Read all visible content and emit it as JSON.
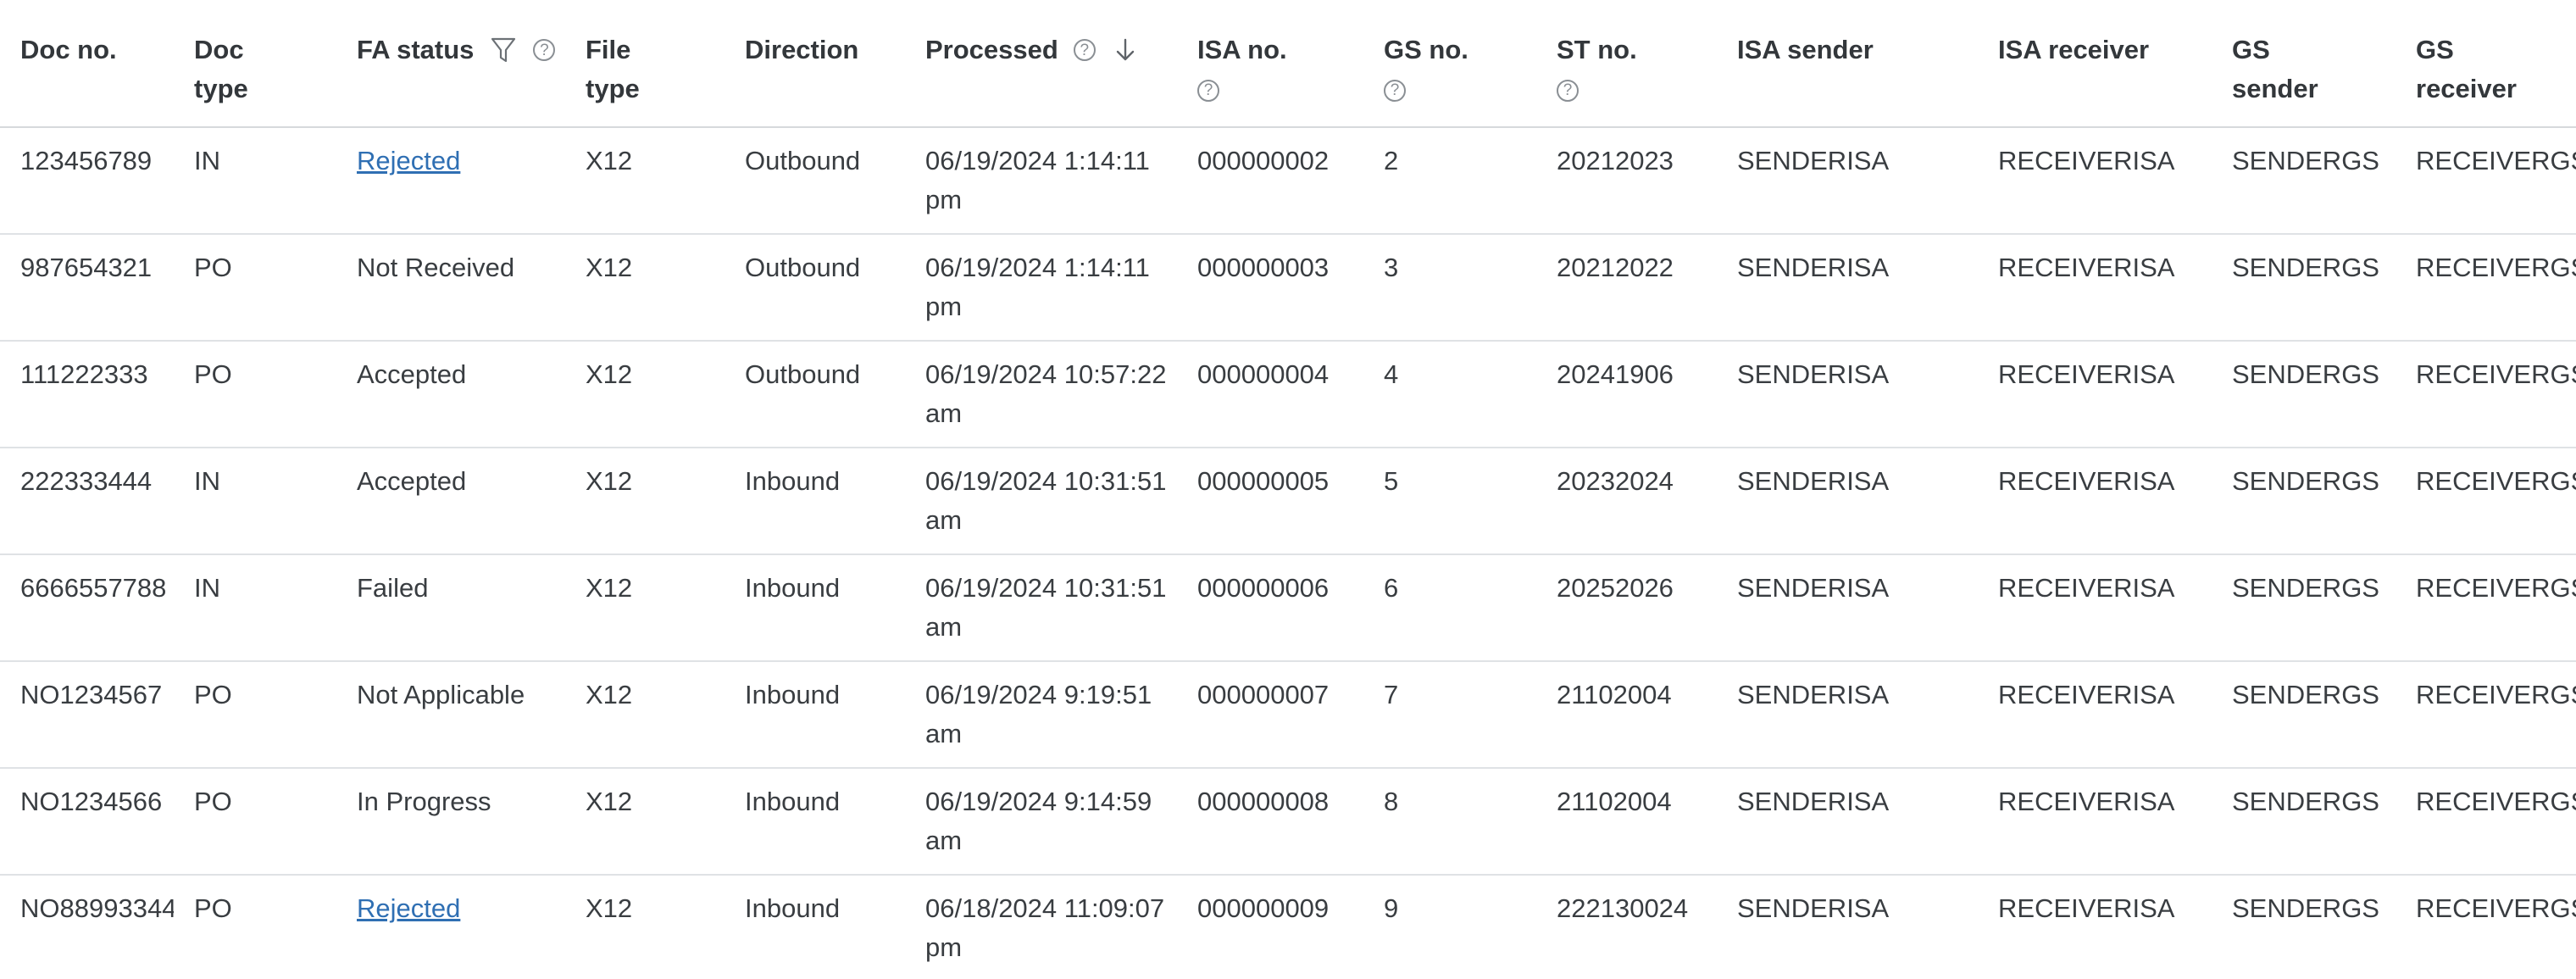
{
  "headers": {
    "doc_no": [
      "Doc no."
    ],
    "doc_type": [
      "Doc",
      "type"
    ],
    "fa_status": "FA status",
    "file_type": [
      "File",
      "type"
    ],
    "direction": [
      "Direction"
    ],
    "processed": "Processed",
    "isa_no": "ISA no.",
    "gs_no": "GS no.",
    "st_no": "ST no.",
    "isa_sender": [
      "ISA sender"
    ],
    "isa_receiver": [
      "ISA receiver"
    ],
    "gs_sender": [
      "GS",
      "sender"
    ],
    "gs_receiver": [
      "GS",
      "receiver"
    ],
    "help_glyph": "?"
  },
  "rows": [
    {
      "doc_no": "123456789",
      "doc_type": "IN",
      "fa_status": "Rejected",
      "fa_link": true,
      "file_type": "X12",
      "direction": "Outbound",
      "processed": [
        "06/19/2024 1:14:11",
        "pm"
      ],
      "isa_no": "000000002",
      "gs_no": "2",
      "st_no": "20212023",
      "isa_sender": "SENDERISA",
      "isa_receiver": "RECEIVERISA",
      "gs_sender": "SENDERGS",
      "gs_receiver": "RECEIVERGS"
    },
    {
      "doc_no": "987654321",
      "doc_type": "PO",
      "fa_status": "Not Received",
      "fa_link": false,
      "file_type": "X12",
      "direction": "Outbound",
      "processed": [
        "06/19/2024 1:14:11",
        "pm"
      ],
      "isa_no": "000000003",
      "gs_no": "3",
      "st_no": "20212022",
      "isa_sender": "SENDERISA",
      "isa_receiver": "RECEIVERISA",
      "gs_sender": "SENDERGS",
      "gs_receiver": "RECEIVERGS"
    },
    {
      "doc_no": "111222333",
      "doc_type": "PO",
      "fa_status": "Accepted",
      "fa_link": false,
      "file_type": "X12",
      "direction": "Outbound",
      "processed": [
        "06/19/2024 10:57:22",
        "am"
      ],
      "isa_no": "000000004",
      "gs_no": "4",
      "st_no": "20241906",
      "isa_sender": "SENDERISA",
      "isa_receiver": "RECEIVERISA",
      "gs_sender": "SENDERGS",
      "gs_receiver": "RECEIVERGS"
    },
    {
      "doc_no": "222333444",
      "doc_type": "IN",
      "fa_status": "Accepted",
      "fa_link": false,
      "file_type": "X12",
      "direction": "Inbound",
      "processed": [
        "06/19/2024 10:31:51",
        "am"
      ],
      "isa_no": "000000005",
      "gs_no": "5",
      "st_no": "20232024",
      "isa_sender": "SENDERISA",
      "isa_receiver": "RECEIVERISA",
      "gs_sender": "SENDERGS",
      "gs_receiver": "RECEIVERGS"
    },
    {
      "doc_no": "6666557788",
      "doc_type": "IN",
      "fa_status": "Failed",
      "fa_link": false,
      "file_type": "X12",
      "direction": "Inbound",
      "processed": [
        "06/19/2024 10:31:51",
        "am"
      ],
      "isa_no": "000000006",
      "gs_no": "6",
      "st_no": "20252026",
      "isa_sender": "SENDERISA",
      "isa_receiver": "RECEIVERISA",
      "gs_sender": "SENDERGS",
      "gs_receiver": "RECEIVERGS"
    },
    {
      "doc_no": "NO1234567",
      "doc_type": "PO",
      "fa_status": "Not Applicable",
      "fa_link": false,
      "file_type": "X12",
      "direction": "Inbound",
      "processed": [
        "06/19/2024 9:19:51",
        "am"
      ],
      "isa_no": "000000007",
      "gs_no": "7",
      "st_no": "21102004",
      "isa_sender": "SENDERISA",
      "isa_receiver": "RECEIVERISA",
      "gs_sender": "SENDERGS",
      "gs_receiver": "RECEIVERGS"
    },
    {
      "doc_no": "NO1234566",
      "doc_type": "PO",
      "fa_status": "In Progress",
      "fa_link": false,
      "file_type": "X12",
      "direction": "Inbound",
      "processed": [
        "06/19/2024 9:14:59",
        "am"
      ],
      "isa_no": "000000008",
      "gs_no": "8",
      "st_no": "21102004",
      "isa_sender": "SENDERISA",
      "isa_receiver": "RECEIVERISA",
      "gs_sender": "SENDERGS",
      "gs_receiver": "RECEIVERGS"
    },
    {
      "doc_no": "NO88993344",
      "doc_type": "PO",
      "fa_status": "Rejected",
      "fa_link": true,
      "file_type": "X12",
      "direction": "Inbound",
      "processed": [
        "06/18/2024 11:09:07",
        "pm"
      ],
      "isa_no": "000000009",
      "gs_no": "9",
      "st_no": "222130024",
      "isa_sender": "SENDERISA",
      "isa_receiver": "RECEIVERISA",
      "gs_sender": "SENDERGS",
      "gs_receiver": "RECEIVERGS"
    }
  ],
  "icons": {
    "filter": "filter-icon",
    "help": "help-icon",
    "sort": "arrow-down-icon"
  },
  "colors": {
    "link": "#2f6fb3",
    "text": "#393d41",
    "header_text": "#33373b",
    "row_border": "#dfe2e5",
    "icon": "#8a8f94"
  }
}
